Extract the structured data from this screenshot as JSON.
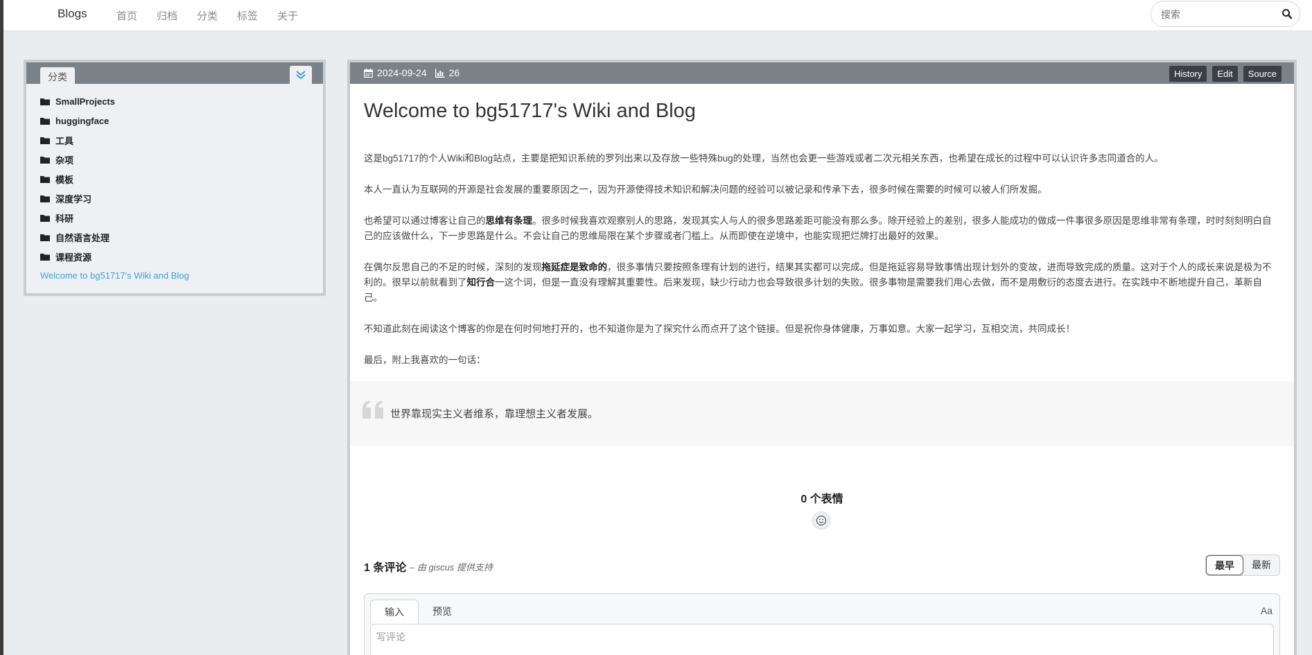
{
  "navbar": {
    "brand": "Blogs",
    "links": [
      "首页",
      "归档",
      "分类",
      "标签",
      "关于"
    ],
    "search_placeholder": "搜索"
  },
  "sidebar": {
    "tab_label": "分类",
    "categories": [
      "SmallProjects",
      "huggingface",
      "工具",
      "杂项",
      "模板",
      "深度学习",
      "科研",
      "自然语言处理",
      "课程资源"
    ],
    "post_link": "Welcome to bg51717's Wiki and Blog"
  },
  "post": {
    "date": "2024-09-24",
    "views": "26",
    "buttons": [
      "History",
      "Edit",
      "Source"
    ],
    "title": "Welcome to bg51717's Wiki and Blog",
    "p1": "这是bg51717的个人Wiki和Blog站点，主要是把知识系统的罗列出来以及存放一些特殊bug的处理，当然也会更一些游戏或者二次元相关东西，也希望在成长的过程中可以认识许多志同道合的人。",
    "p2": "本人一直认为互联网的开源是社会发展的重要原因之一，因为开源使得技术知识和解决问题的经验可以被记录和传承下去，很多时候在需要的时候可以被人们所发掘。",
    "p3_a": "也希望可以通过博客让自己的",
    "p3_b": "思维有条理",
    "p3_c": "。很多时候我喜欢观察别人的思路，发现其实人与人的很多思路差距可能没有那么多。除开经验上的差别，很多人能成功的做成一件事很多原因是思维非常有条理，时时刻刻明白自己的应该做什么，下一步思路是什么。不会让自己的思维局限在某个步骤或者门槛上。从而即使在逆境中，也能实现把烂牌打出最好的效果。",
    "p4_a": "在偶尔反思自己的不足的时候，深刻的发现",
    "p4_b": "拖延症是致命的",
    "p4_c": "，很多事情只要按照条理有计划的进行，结果其实都可以完成。但是拖延容易导致事情出现计划外的变故，进而导致完成的质量。这对于个人的成长来说是极为不利的。很早以前就看到了",
    "p4_d": "知行合",
    "p4_e": "一这个词，但是一直没有理解其重要性。后来发现，缺少行动力也会导致很多计划的失败。很多事物是需要我们用心去做，而不是用敷衍的态度去进行。在实践中不断地提升自己，革新自己。",
    "p5": "不知道此刻在阅读这个博客的你是在何时何地打开的，也不知道你是为了探究什么而点开了这个链接。但是祝你身体健康，万事如意。大家一起学习，互相交流，共同成长！",
    "p6": "最后，附上我喜欢的一句话：",
    "quote": "世界靠现实主义者维系，靠理想主义者发展。"
  },
  "comments": {
    "reactions_title": "0 个表情",
    "count_label": "1 条评论",
    "powered_by": "– 由 giscus 提供支持",
    "sort_oldest": "最早",
    "sort_newest": "最新",
    "tab_write": "输入",
    "tab_preview": "预览",
    "format_label": "Aa",
    "placeholder": "写评论"
  }
}
